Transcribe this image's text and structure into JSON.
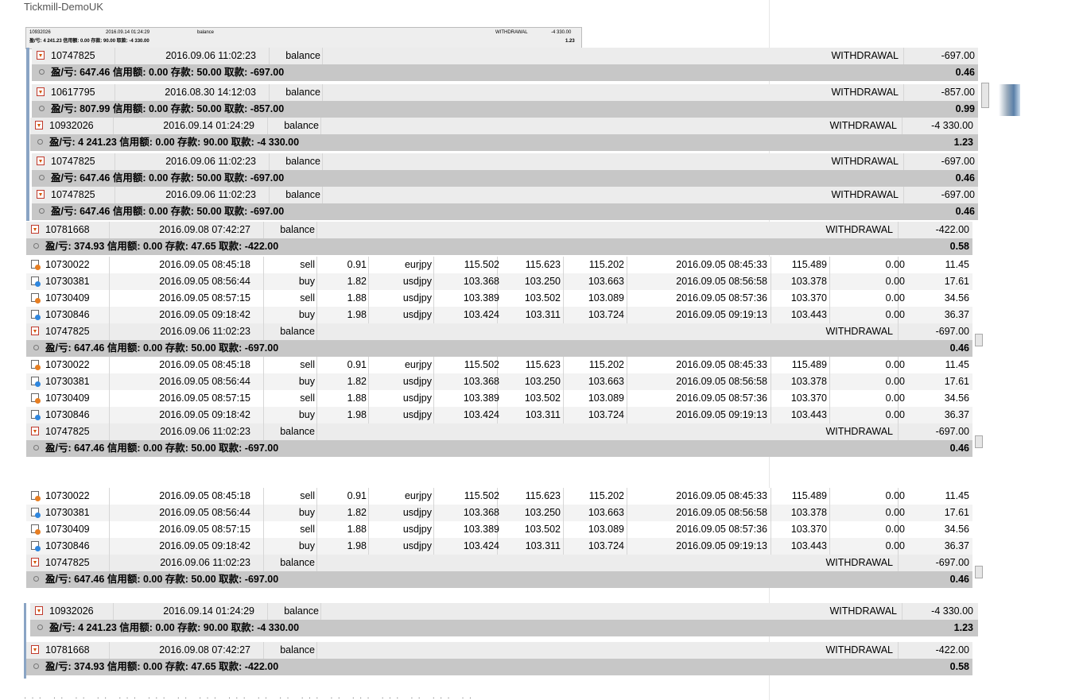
{
  "window": {
    "title": "Tickmill-DemoUK"
  },
  "thumbnail": {
    "ticket": "10932026",
    "time": "2016.09.14 01:24:29",
    "type": "balance",
    "comment": "WITHDRAWAL",
    "amount": "-4 330.00",
    "summary": "盈/亏: 4 241.23  信用额: 0.00  存款: 90.00  取款: -4 330.00",
    "total": "1.23"
  },
  "labels": {
    "sell": "sell",
    "buy": "buy",
    "balance": "balance",
    "withdrawal": "WITHDRAWAL"
  },
  "trades": [
    {
      "ticket": "10730022",
      "open_time": "2016.09.05 08:45:18",
      "type": "sell",
      "size": "0.91",
      "symbol": "eurjpy",
      "price": "115.502",
      "sl": "115.623",
      "tp": "115.202",
      "close_time": "2016.09.05 08:45:33",
      "close_price": "115.489",
      "swap": "0.00",
      "profit": "11.45"
    },
    {
      "ticket": "10730381",
      "open_time": "2016.09.05 08:56:44",
      "type": "buy",
      "size": "1.82",
      "symbol": "usdjpy",
      "price": "103.368",
      "sl": "103.250",
      "tp": "103.663",
      "close_time": "2016.09.05 08:56:58",
      "close_price": "103.378",
      "swap": "0.00",
      "profit": "17.61"
    },
    {
      "ticket": "10730409",
      "open_time": "2016.09.05 08:57:15",
      "type": "sell",
      "size": "1.88",
      "symbol": "usdjpy",
      "price": "103.389",
      "sl": "103.502",
      "tp": "103.089",
      "close_time": "2016.09.05 08:57:36",
      "close_price": "103.370",
      "swap": "0.00",
      "profit": "34.56"
    },
    {
      "ticket": "10730846",
      "open_time": "2016.09.05 09:18:42",
      "type": "buy",
      "size": "1.98",
      "symbol": "usdjpy",
      "price": "103.424",
      "sl": "103.311",
      "tp": "103.724",
      "close_time": "2016.09.05 09:19:13",
      "close_price": "103.443",
      "swap": "0.00",
      "profit": "36.37"
    }
  ],
  "balances": {
    "b10747825": {
      "ticket": "10747825",
      "time": "2016.09.06 11:02:23",
      "amount": "-697.00",
      "summary": "盈/亏: 647.46  信用额: 0.00  存款: 50.00  取款: -697.00",
      "total": "0.46"
    },
    "b10617795": {
      "ticket": "10617795",
      "time": "2016.08.30 14:12:03",
      "amount": "-857.00",
      "summary": "盈/亏: 807.99  信用额: 0.00  存款: 50.00  取款: -857.00",
      "total": "0.99"
    },
    "b10932026": {
      "ticket": "10932026",
      "time": "2016.09.14 01:24:29",
      "amount": "-4 330.00",
      "summary": "盈/亏: 4 241.23  信用额: 0.00  存款: 90.00  取款: -4 330.00",
      "total": "1.23"
    },
    "b10781668": {
      "ticket": "10781668",
      "time": "2016.09.08 07:42:27",
      "amount": "-422.00",
      "summary": "盈/亏: 374.93  信用额: 0.00  存款: 47.65  取款: -422.00",
      "total": "0.58"
    }
  },
  "footer": {
    "text": "··· ·· ·· ·· ··· ··· ·· ··· ··· ·· ·· ··· ·· ··· ··· ·· ··· ··"
  }
}
